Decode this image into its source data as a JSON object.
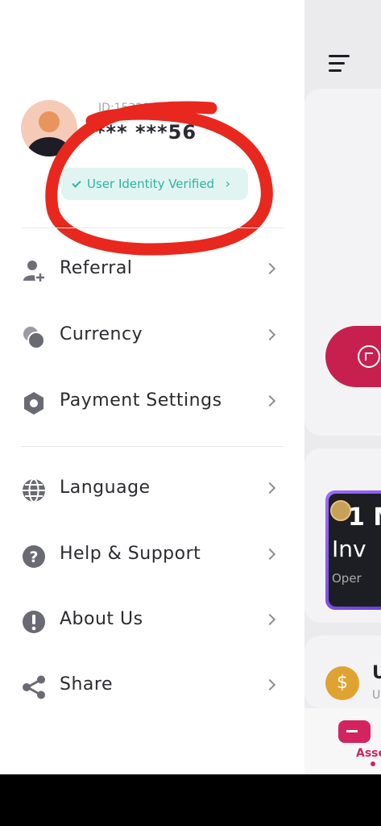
{
  "profile": {
    "id_text": "ID:15221",
    "masked_name": "*** ***56",
    "verified_label": "User Identity Verified"
  },
  "menu": {
    "items": [
      {
        "label": "Referral",
        "icon": "referral-icon"
      },
      {
        "label": "Currency",
        "icon": "currency-icon"
      },
      {
        "label": "Payment Settings",
        "icon": "payment-settings-icon"
      },
      {
        "label": "Language",
        "icon": "globe-icon"
      },
      {
        "label": "Help & Support",
        "icon": "help-icon"
      },
      {
        "label": "About Us",
        "icon": "info-icon"
      },
      {
        "label": "Share",
        "icon": "share-icon"
      }
    ]
  },
  "background_app": {
    "promo_line1": "1 M",
    "promo_line2": "Inv",
    "promo_line3": "Oper",
    "list_title": "U",
    "list_sub": "U",
    "tab_label": "Asse"
  },
  "colors": {
    "accent_teal": "#2fb3a0",
    "brand_pink": "#d42460",
    "annotation_red": "#e8281e"
  }
}
